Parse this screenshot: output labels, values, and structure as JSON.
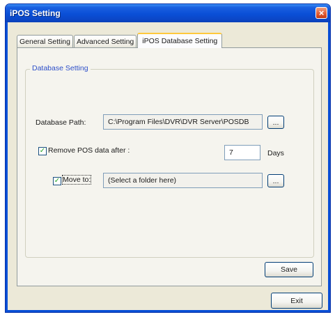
{
  "window": {
    "title": "iPOS Setting",
    "close_icon": "close-icon"
  },
  "tabs": [
    {
      "label": "General Setting",
      "active": false
    },
    {
      "label": "Advanced Setting",
      "active": false
    },
    {
      "label": "iPOS Database Setting",
      "active": true
    }
  ],
  "group": {
    "legend": "Database Setting"
  },
  "db_path": {
    "label": "Database Path:",
    "value": "C:\\Program Files\\DVR\\DVR Server\\POSDB",
    "browse_label": "..."
  },
  "remove": {
    "label": "Remove POS data after :",
    "checked": true,
    "value": "7",
    "unit": "Days"
  },
  "move_to": {
    "label": "Move to:",
    "checked": true,
    "value": "(Select a folder here)",
    "browse_label": "..."
  },
  "buttons": {
    "save": "Save",
    "exit": "Exit"
  },
  "colors": {
    "title_bar": "#0a4fd6",
    "legend": "#2d4fc9",
    "check": "#21a121"
  }
}
